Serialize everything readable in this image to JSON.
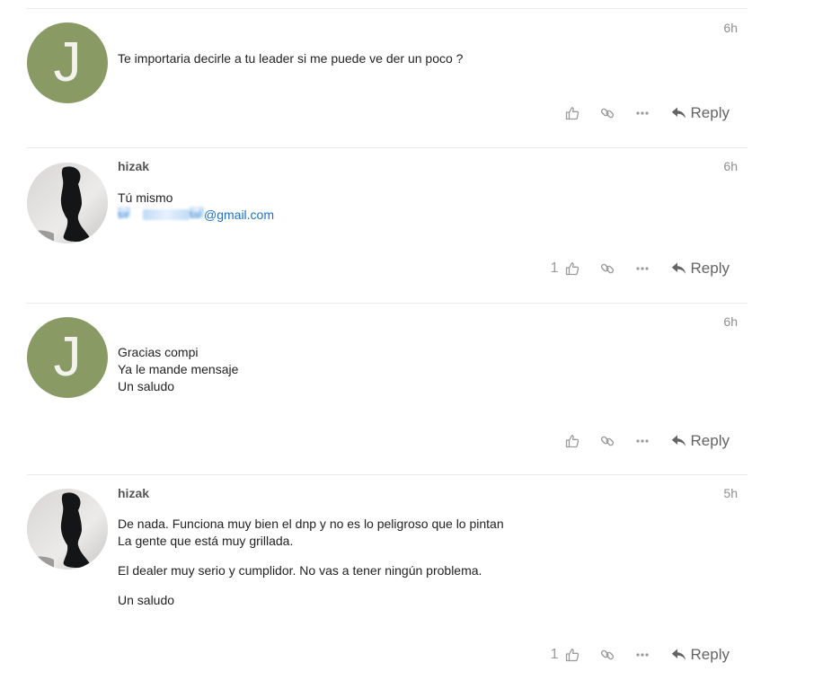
{
  "posts": [
    {
      "avatar_letter": "J",
      "username": "",
      "time": "6h",
      "lines": [
        "Te importaria decirle a tu leader si me puede ve der un poco ?"
      ],
      "likes": "",
      "reply_label": "Reply"
    },
    {
      "avatar_letter": "",
      "username": "hizak",
      "time": "6h",
      "lines": [
        "Tú mismo"
      ],
      "email_prefix": "sir",
      "email_mid": "tal",
      "email_domain": "@gmail.com",
      "likes": "1",
      "reply_label": "Reply"
    },
    {
      "avatar_letter": "J",
      "username": "",
      "time": "6h",
      "lines": [
        "Gracias compi",
        "Ya le mande mensaje",
        "Un saludo"
      ],
      "likes": "",
      "reply_label": "Reply"
    },
    {
      "avatar_letter": "",
      "username": "hizak",
      "time": "5h",
      "lines": [
        "De nada. Funciona muy bien el dnp y no es lo peligroso que lo pintan",
        "La gente que está muy grillada.",
        "El dealer muy serio y cumplidor. No vas a tener ningún problema.",
        "Un saludo"
      ],
      "likes": "1",
      "reply_label": "Reply"
    }
  ],
  "colors": {
    "letter_avatar_bg": "#8a9a65",
    "link": "#1c72c4",
    "muted": "#9a9a9a"
  },
  "icons": {
    "like": "thumbs-up-icon",
    "link": "link-icon",
    "more": "ellipsis-icon",
    "reply": "reply-arrow-icon"
  }
}
